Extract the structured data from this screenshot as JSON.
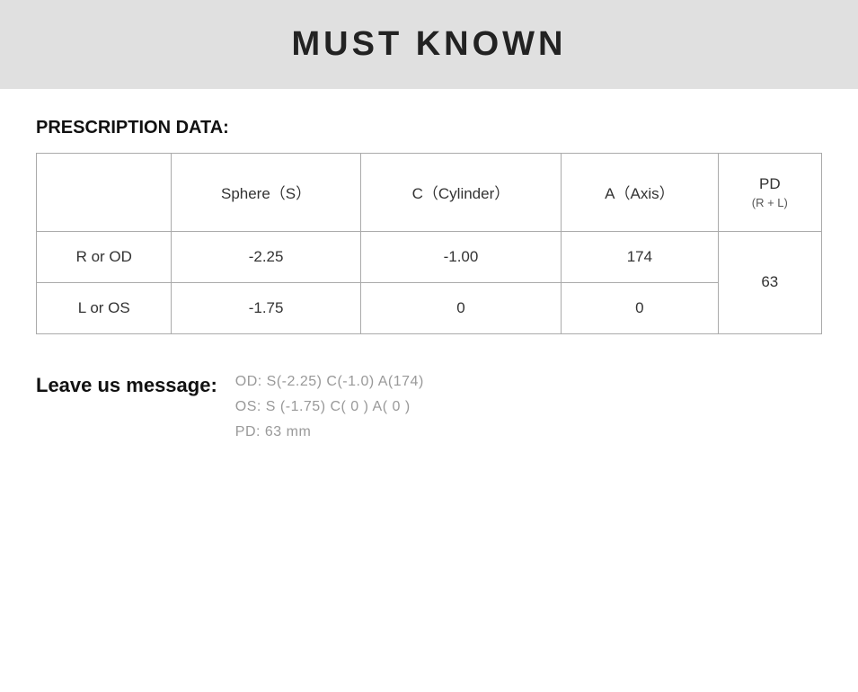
{
  "header": {
    "title": "MUST KNOWN"
  },
  "prescription": {
    "section_label": "PRESCRIPTION DATA:",
    "columns": {
      "empty": "",
      "sphere": "Sphere（S）",
      "cylinder": "C（Cylinder）",
      "axis": "A（Axis）",
      "pd_main": "PD",
      "pd_sub": "(R + L)"
    },
    "rows": [
      {
        "label": "R or OD",
        "sphere": "-2.25",
        "cylinder": "-1.00",
        "axis": "174"
      },
      {
        "label": "L or OS",
        "sphere": "-1.75",
        "cylinder": "0",
        "axis": "0"
      }
    ],
    "pd_value": "63"
  },
  "leave_message": {
    "label": "Leave us message:",
    "lines": [
      "OD:  S(-2.25)    C(-1.0)   A(174)",
      "OS:  S (-1.75)   C( 0 )    A( 0 )",
      "PD:  63 mm"
    ]
  }
}
